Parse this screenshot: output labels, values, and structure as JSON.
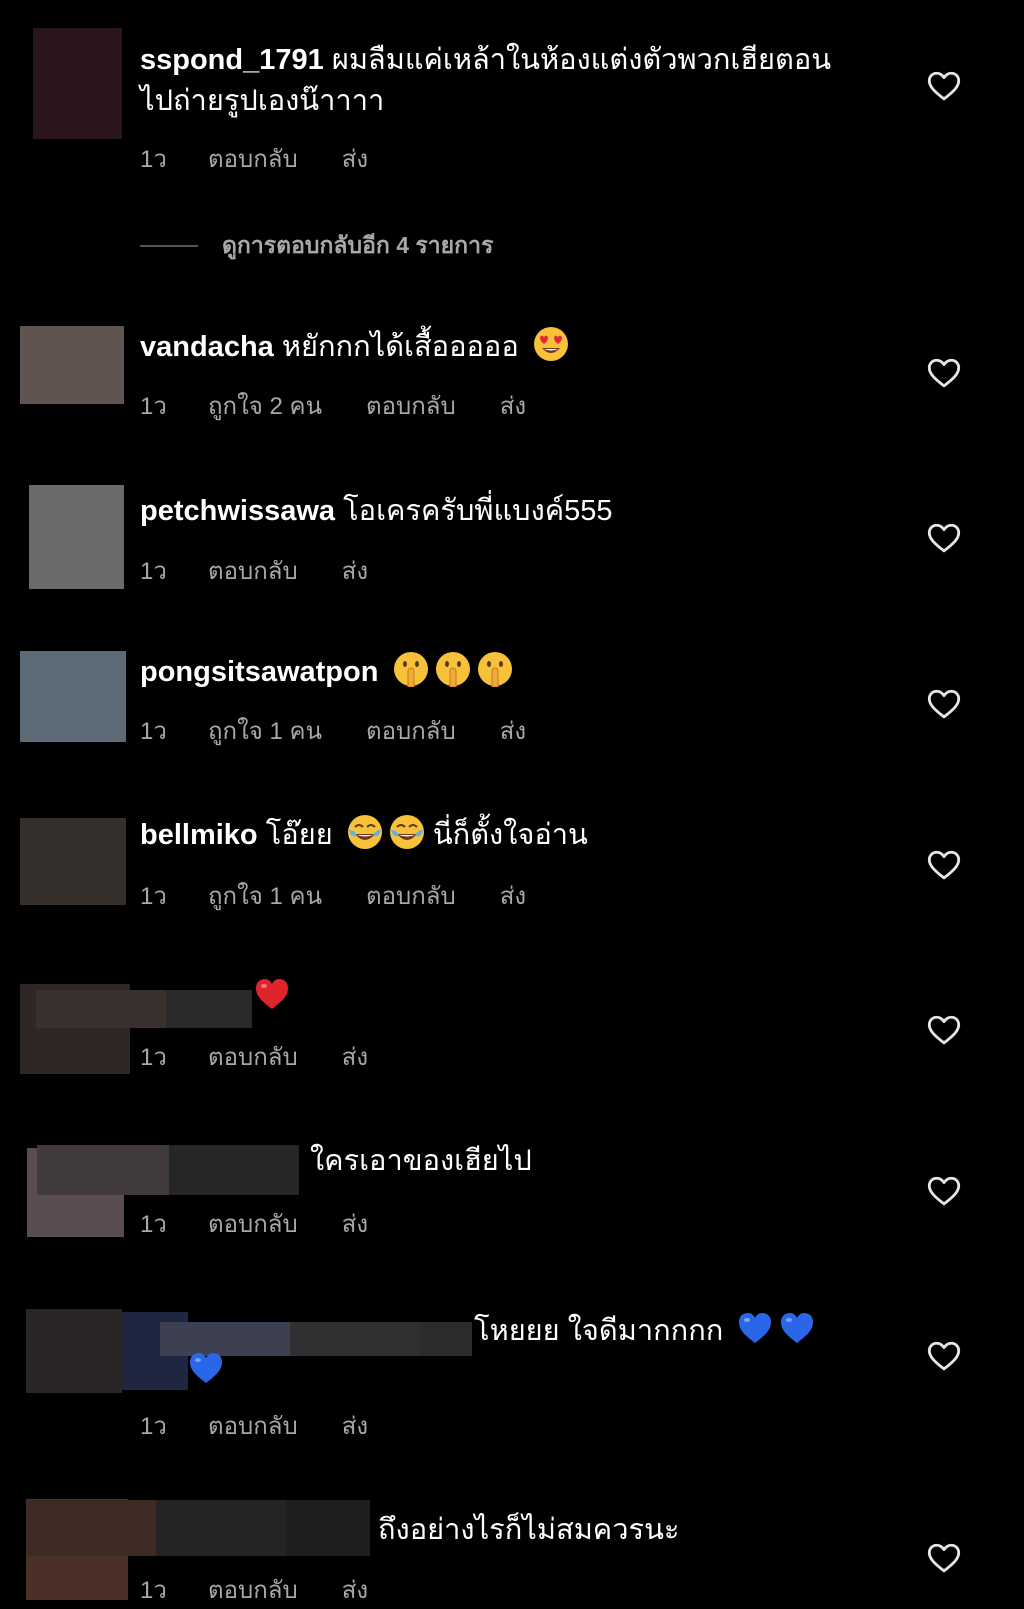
{
  "colors": {
    "background": "#000000",
    "text": "#ffffff",
    "secondary_text": "#a8a8a8"
  },
  "comments": [
    {
      "username": "sspond_1791",
      "text": "ผมลืมแค่เหล้าในห้องแต่งตัวพวกเฮียตอน",
      "text_cont": "ไปถ่ายรูปเองน๊าาาา",
      "time": "1ว",
      "reply": "ตอบกลับ",
      "send": "ส่ง"
    },
    {
      "username": "vandacha",
      "text": "หยักกกได้เสื้อออออ",
      "emoji": "heart-eyes-emoji",
      "time": "1ว",
      "likes": "ถูกใจ 2 คน",
      "reply": "ตอบกลับ",
      "send": "ส่ง"
    },
    {
      "username": "petchwissawa",
      "text": "โอเครครับพี่แบงค์555",
      "time": "1ว",
      "reply": "ตอบกลับ",
      "send": "ส่ง"
    },
    {
      "username": "pongsitsawatpon",
      "text": "",
      "emoji": "shushing-face-emoji",
      "time": "1ว",
      "likes": "ถูกใจ 1 คน",
      "reply": "ตอบกลับ",
      "send": "ส่ง"
    },
    {
      "username": "bellmiko",
      "text": "โอ๊ยย",
      "text_after": "นี่ก็ตั้งใจอ่าน",
      "emoji": "tears-of-joy-emoji",
      "time": "1ว",
      "likes": "ถูกใจ 1 คน",
      "reply": "ตอบกลับ",
      "send": "ส่ง"
    },
    {
      "username": "",
      "emoji": "red-heart-emoji",
      "time": "1ว",
      "reply": "ตอบกลับ",
      "send": "ส่ง"
    },
    {
      "username": "",
      "text": "ใครเอาของเฮียไป",
      "time": "1ว",
      "reply": "ตอบกลับ",
      "send": "ส่ง"
    },
    {
      "username": "",
      "text": "โหยยย ใจดีมากกกก",
      "emoji": "blue-heart-emoji",
      "time": "1ว",
      "reply": "ตอบกลับ",
      "send": "ส่ง"
    },
    {
      "username": "",
      "text": "ถึงอย่างไรก็ไม่สมควรนะ",
      "time": "1ว",
      "reply": "ตอบกลับ",
      "send": "ส่ง"
    }
  ],
  "view_replies": "ดูการตอบกลับอีก 4 รายการ",
  "like_icon": "heart-outline-icon"
}
